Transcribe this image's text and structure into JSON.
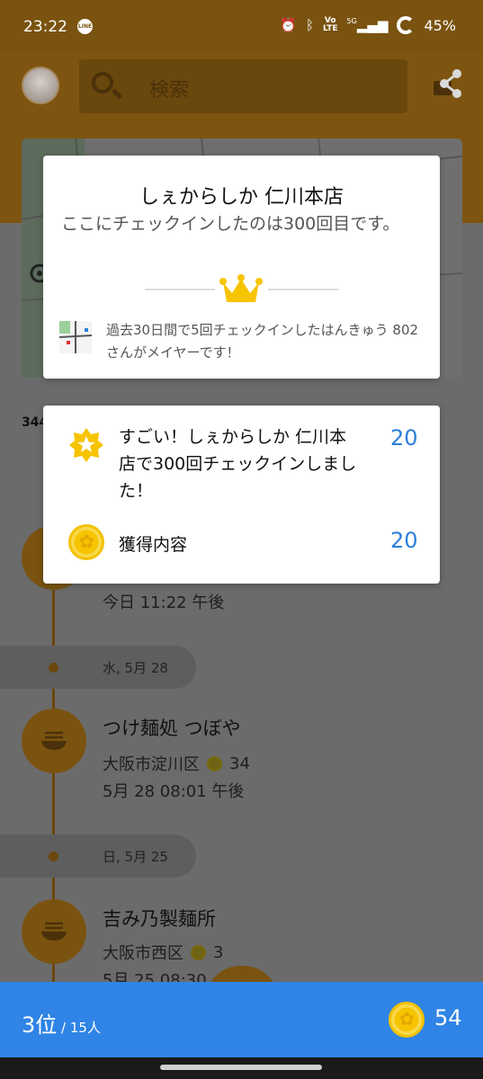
{
  "status": {
    "time": "23:22",
    "line": "LINE",
    "lte": "Vo\nLTE",
    "net": "5G",
    "battery": "45%"
  },
  "header": {
    "search_placeholder": "検索"
  },
  "list": {
    "count_partial": "344",
    "dates": [
      "水, 5月 28",
      "日, 5月 25"
    ],
    "partial_time": "今日 11:22 午後",
    "venues": [
      {
        "name": "つけ麺処 つぼや",
        "area": "大阪市淀川区",
        "coins": "34",
        "time": "5月 28 08:01 午後"
      },
      {
        "name": "吉み乃製麺所",
        "area": "大阪市西区",
        "coins": "3",
        "time": "5月 25 08:30"
      }
    ]
  },
  "dialog_checkin": {
    "title": "しぇからしか 仁川本店",
    "subtitle": "ここにチェックインしたのは300回目です。",
    "mayor_text": "過去30日間で5回チェックインしたはんきゅう 802さんがメイヤーです！"
  },
  "dialog_reward": {
    "message": "すごい！しぇからしか 仁川本店で300回チェックインしました！",
    "points_1": "20",
    "label": "獲得内容",
    "points_2": "20"
  },
  "bottom": {
    "rank": "3位",
    "rank_total": " / 15人",
    "coins": "54"
  },
  "colors": {
    "accent_blue": "#2f84e6",
    "brand_orange": "#e8a21e",
    "coin": "#f7c400",
    "points": "#2a7fd9"
  }
}
